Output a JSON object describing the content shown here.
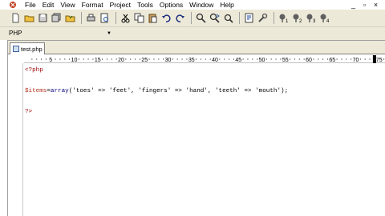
{
  "menubar": {
    "items": [
      "File",
      "Edit",
      "View",
      "Format",
      "Project",
      "Tools",
      "Options",
      "Window",
      "Help"
    ],
    "window_controls": [
      "minimize",
      "restore",
      "close"
    ]
  },
  "toolbar": {
    "buttons": [
      "new-file",
      "open-folder",
      "save",
      "save-all",
      "open",
      "print",
      "print-preview",
      "cut",
      "copy",
      "paste",
      "undo",
      "redo",
      "find",
      "find-next",
      "replace",
      "goto",
      "tools",
      "bookmark-1",
      "bookmark-2",
      "bookmark-3",
      "bookmark-4"
    ]
  },
  "language": {
    "selected": "PHP"
  },
  "tabs": [
    {
      "label": "test.php",
      "active": true
    }
  ],
  "ruler": {
    "labels": [
      "5",
      "10",
      "15",
      "20",
      "25",
      "30",
      "35",
      "40",
      "45",
      "50",
      "55",
      "60",
      "65",
      "70",
      "75"
    ]
  },
  "code": {
    "line1": "<?php",
    "line3_var": "$items",
    "line3_eq": "=",
    "line3_fn": "array",
    "line3_args": "('toes' => 'feet', 'fingers' => 'hand', 'teeth' => 'mouth');",
    "line5": "?>"
  },
  "colors": {
    "php_tag": "#9c0000",
    "variable": "#b0331f",
    "function": "#000080",
    "toolbar_bg": "#ece9d8"
  }
}
